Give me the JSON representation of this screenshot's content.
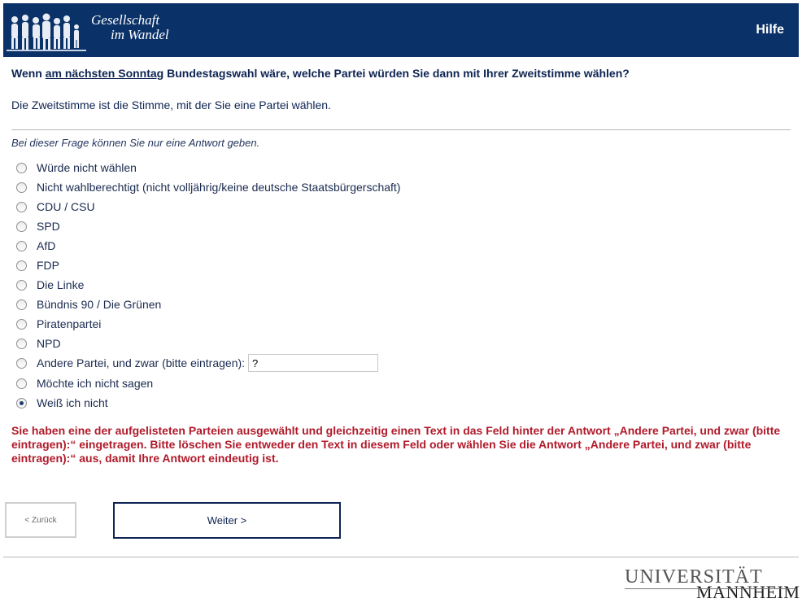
{
  "header": {
    "logo_line1": "Gesellschaft",
    "logo_line2": "im Wandel",
    "help_label": "Hilfe",
    "bg_color": "#0b3268"
  },
  "question": {
    "part1": "Wenn ",
    "underlined": "am nächsten Sonntag",
    "part2": " Bundestagswahl wäre, welche Partei würden Sie dann mit Ihrer Zweitstimme wählen?"
  },
  "explanation": "Die Zweitstimme ist die Stimme, mit der Sie eine Partei wählen.",
  "instruction": "Bei dieser Frage können Sie nur eine Antwort geben.",
  "options": [
    {
      "label": "Würde nicht wählen",
      "checked": false
    },
    {
      "label": "Nicht wahlberechtigt (nicht volljährig/keine deutsche Staatsbürgerschaft)",
      "checked": false
    },
    {
      "label": "CDU / CSU",
      "checked": false
    },
    {
      "label": "SPD",
      "checked": false
    },
    {
      "label": "AfD",
      "checked": false
    },
    {
      "label": "FDP",
      "checked": false
    },
    {
      "label": "Die Linke",
      "checked": false
    },
    {
      "label": "Bündnis 90 / Die Grünen",
      "checked": false
    },
    {
      "label": "Piratenpartei",
      "checked": false
    },
    {
      "label": "NPD",
      "checked": false
    },
    {
      "label": "Andere Partei, und zwar (bitte eintragen):",
      "checked": false
    },
    {
      "label": "Möchte ich nicht sagen",
      "checked": false
    },
    {
      "label": "Weiß ich nicht",
      "checked": true
    }
  ],
  "other_party_input": {
    "value": "?"
  },
  "error_message": "Sie haben eine der aufgelisteten Parteien ausgewählt und gleichzeitig einen Text in das Feld hinter der Antwort „Andere Partei, und zwar (bitte eintragen):“ eingetragen. Bitte löschen Sie entweder den Text in diesem Feld oder wählen Sie die Antwort „Andere Partei, und zwar (bitte eintragen):“ aus, damit Ihre Antwort eindeutig ist.",
  "nav": {
    "back_label": "< Zurück",
    "next_label": "Weiter >"
  },
  "footer": {
    "uni_line1": "UNIVERSITÄT",
    "uni_line2": "MANNHEIM"
  }
}
